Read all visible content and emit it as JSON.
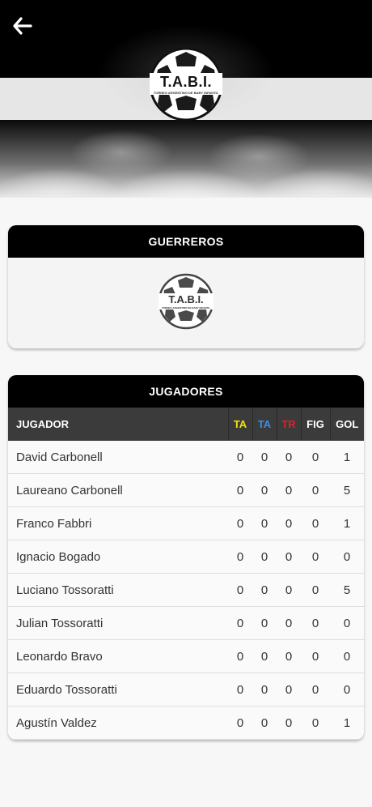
{
  "header": {
    "back_icon": "arrow-left-icon",
    "logo": {
      "title": "T.A.B.I.",
      "subtitle": "TORNEO ARGENTINO DE BABY INFANTIL"
    }
  },
  "team": {
    "name": "GUERREROS",
    "logo": {
      "title": "T.A.B.I.",
      "subtitle": "TORNEO ARGENTINO DE BABY INFANTIL"
    }
  },
  "players": {
    "title": "JUGADORES",
    "columns": [
      "JUGADOR",
      "TA",
      "TA",
      "TR",
      "FIG",
      "GOL"
    ],
    "colors": {
      "ta_yellow": "#f5e20a",
      "ta_blue": "#3a8fe0",
      "tr_red": "#e0202a"
    },
    "rows": [
      {
        "name": "David Carbonell",
        "ta_y": "0",
        "ta_b": "0",
        "tr": "0",
        "fig": "0",
        "gol": "1"
      },
      {
        "name": "Laureano Carbonell",
        "ta_y": "0",
        "ta_b": "0",
        "tr": "0",
        "fig": "0",
        "gol": "5"
      },
      {
        "name": "Franco Fabbri",
        "ta_y": "0",
        "ta_b": "0",
        "tr": "0",
        "fig": "0",
        "gol": "1"
      },
      {
        "name": "Ignacio Bogado",
        "ta_y": "0",
        "ta_b": "0",
        "tr": "0",
        "fig": "0",
        "gol": "0"
      },
      {
        "name": "Luciano Tossoratti",
        "ta_y": "0",
        "ta_b": "0",
        "tr": "0",
        "fig": "0",
        "gol": "5"
      },
      {
        "name": "Julian Tossoratti",
        "ta_y": "0",
        "ta_b": "0",
        "tr": "0",
        "fig": "0",
        "gol": "0"
      },
      {
        "name": "Leonardo Bravo",
        "ta_y": "0",
        "ta_b": "0",
        "tr": "0",
        "fig": "0",
        "gol": "0"
      },
      {
        "name": "Eduardo Tossoratti",
        "ta_y": "0",
        "ta_b": "0",
        "tr": "0",
        "fig": "0",
        "gol": "0"
      },
      {
        "name": "Agustín Valdez",
        "ta_y": "0",
        "ta_b": "0",
        "tr": "0",
        "fig": "0",
        "gol": "1"
      }
    ]
  }
}
